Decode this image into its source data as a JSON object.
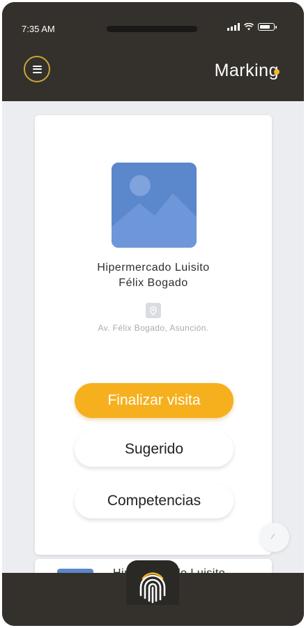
{
  "status": {
    "time": "7:35 AM"
  },
  "appbar": {
    "brand": "Marking"
  },
  "store": {
    "name_line1": "Hipermercado Luisito",
    "name_line2": "Félix Bogado",
    "address": "Av. Félix Bogado, Asunción."
  },
  "actions": {
    "finalize": "Finalizar visita",
    "suggested": "Sugerido",
    "competencies": "Competencias"
  },
  "next_card": {
    "title": "Hipermercado Luisito"
  },
  "colors": {
    "accent": "#f6b01e",
    "bar": "#34312c",
    "background": "#ebedf0",
    "image_placeholder": "#5b87cc"
  },
  "icons": [
    "menu-icon",
    "location-pin-icon",
    "image-placeholder-icon",
    "fingerprint-icon",
    "chevron-icon",
    "signal-icon",
    "wifi-icon",
    "battery-icon"
  ]
}
